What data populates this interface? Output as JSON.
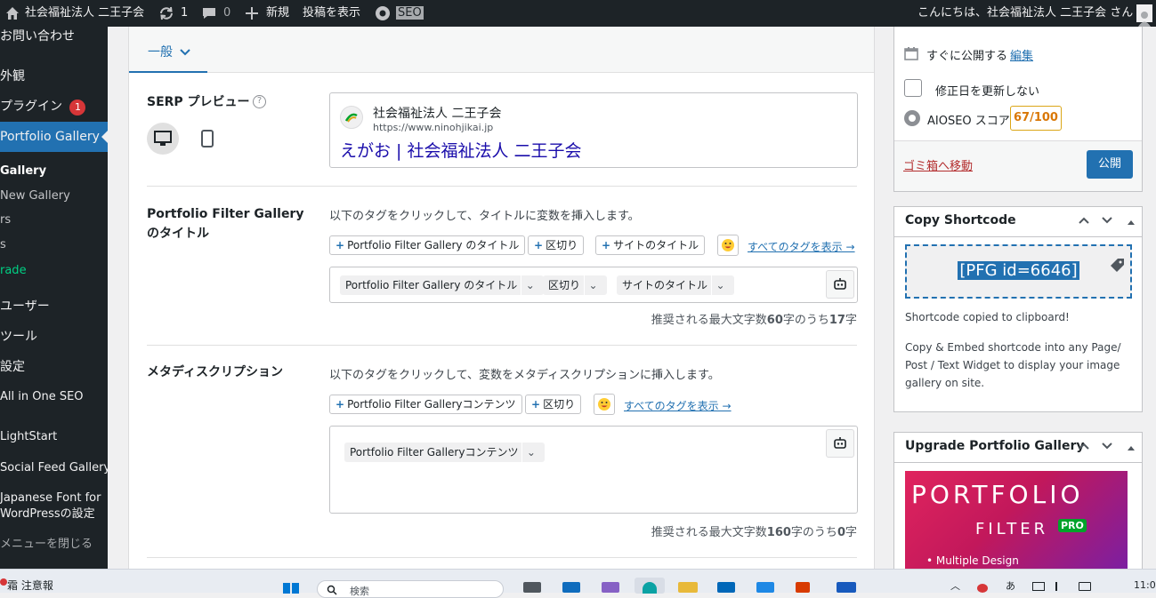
{
  "admin_bar": {
    "site_name": "社会福祉法人 二王子会",
    "updates_count": "1",
    "comments_count": "0",
    "new_label": "新規",
    "view_posts_label": "投稿を表示",
    "seo_label": "SEO",
    "greeting": "こんにちは、社会福祉法人 二王子会 さん"
  },
  "sidebar": {
    "items": [
      {
        "label": "お問い合わせ"
      },
      {
        "label": "外観"
      },
      {
        "label": "プラグイン",
        "badge": "1"
      },
      {
        "label": "Portfolio Gallery"
      },
      {
        "label": "Gallery"
      },
      {
        "label": "New Gallery"
      },
      {
        "label": "rs"
      },
      {
        "label": "s"
      },
      {
        "label": "rade"
      },
      {
        "label": "ユーザー"
      },
      {
        "label": "ツール"
      },
      {
        "label": "設定"
      },
      {
        "label": "All in One SEO"
      },
      {
        "label": "LightStart"
      },
      {
        "label": "Social Feed Gallery"
      },
      {
        "label": "Japanese Font for"
      },
      {
        "label": "WordPressの設定"
      },
      {
        "label": "メニューを閉じる"
      }
    ]
  },
  "main": {
    "tab_general": "一般",
    "serp": {
      "label": "SERP プレビュー",
      "site_name": "社会福祉法人 二王子会",
      "url": "https://www.ninohjikai.jp",
      "title": "えがお | 社会福祉法人 二王子会"
    },
    "title_section": {
      "label": "Portfolio Filter Gallery のタイトル",
      "instruction": "以下のタグをクリックして、タイトルに変数を挿入します。",
      "tags": [
        "Portfolio Filter Gallery のタイトル",
        "区切り",
        "サイトのタイトル"
      ],
      "show_all": "すべてのタグを表示 →",
      "chips": [
        "Portfolio Filter Gallery のタイトル",
        "区切り",
        "サイトのタイトル"
      ],
      "count_prefix": "推奨される最大文字数",
      "count_max": "60",
      "count_mid": "字のうち",
      "count_current": "17",
      "count_suffix": "字"
    },
    "meta_section": {
      "label": "メタディスクリプション",
      "instruction": "以下のタグをクリックして、変数をメタディスクリプションに挿入します。",
      "tags": [
        "Portfolio Filter Galleryコンテンツ",
        "区切り"
      ],
      "show_all": "すべてのタグを表示 →",
      "chips": [
        "Portfolio Filter Galleryコンテンツ"
      ],
      "count_prefix": "推奨される最大文字数",
      "count_max": "160",
      "count_mid": "字のうち",
      "count_current": "0",
      "count_suffix": "字"
    }
  },
  "publish_panel": {
    "publish_immediately": "すぐに公開する",
    "edit_link": "編集",
    "update_date_label": "修正日を更新しない",
    "aioseo_label": "AIOSEO スコア",
    "aioseo_score": "67/100",
    "trash_link": "ゴミ箱へ移動",
    "publish_button": "公開"
  },
  "shortcode_panel": {
    "title": "Copy Shortcode",
    "shortcode": "[PFG id=6646]",
    "copied_msg": "Shortcode copied to clipboard!",
    "help_text": "Copy & Embed shortcode into any Page/ Post / Text Widget to display your image gallery on site."
  },
  "upgrade_panel": {
    "title": "Upgrade Portfolio Gallery",
    "banner_line1": "PORTFOLIO",
    "banner_line2": "FILTER",
    "banner_pro": "PRO",
    "banner_feature": "• Multiple Design"
  },
  "taskbar": {
    "weather": "注意報",
    "search_placeholder": "検索",
    "clock": "11:0"
  },
  "colors": {
    "admin_dark": "#1d2327",
    "accent_blue": "#2271b1",
    "warn_orange": "#dba617",
    "danger_red": "#b32d2e"
  }
}
